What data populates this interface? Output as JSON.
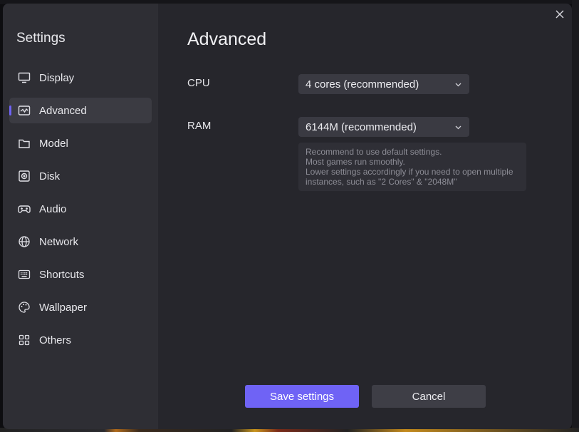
{
  "sidebar": {
    "title": "Settings",
    "items": [
      {
        "label": "Display",
        "icon": "monitor-icon"
      },
      {
        "label": "Advanced",
        "icon": "advanced-icon",
        "active": true
      },
      {
        "label": "Model",
        "icon": "folder-icon"
      },
      {
        "label": "Disk",
        "icon": "disk-icon"
      },
      {
        "label": "Audio",
        "icon": "gamepad-icon"
      },
      {
        "label": "Network",
        "icon": "globe-icon"
      },
      {
        "label": "Shortcuts",
        "icon": "keyboard-icon"
      },
      {
        "label": "Wallpaper",
        "icon": "palette-icon"
      },
      {
        "label": "Others",
        "icon": "grid-icon"
      }
    ]
  },
  "content": {
    "title": "Advanced",
    "cpu": {
      "label": "CPU",
      "value": "4 cores (recommended)"
    },
    "ram": {
      "label": "RAM",
      "value": "6144M (recommended)"
    },
    "note": {
      "line1": "Recommend to use default settings.",
      "line2": "Most games run smoothly.",
      "line3": "Lower settings accordingly if you need to open multiple",
      "line4": "instances, such as \"2 Cores\" & \"2048M\""
    }
  },
  "actions": {
    "save_label": "Save settings",
    "cancel_label": "Cancel"
  },
  "colors": {
    "accent": "#6f63f5",
    "sidebar_bg": "#2e2e34",
    "content_bg": "#26262c"
  }
}
